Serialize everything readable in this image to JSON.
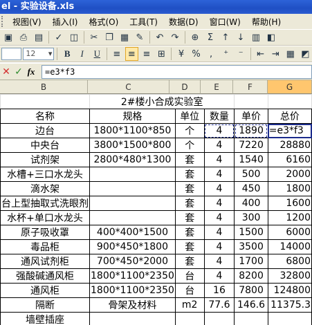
{
  "window": {
    "title": "el - 实验设备.xls"
  },
  "menu": [
    "视图(V)",
    "插入(I)",
    "格式(O)",
    "工具(T)",
    "数据(D)",
    "窗口(W)",
    "帮助(H)"
  ],
  "toolbar": {
    "font_size": "12",
    "zoom_symbol": "Σ"
  },
  "formula_bar": {
    "cancel": "✕",
    "enter": "✓",
    "fx": "fx",
    "value": "=e3*f3"
  },
  "columns": [
    "B",
    "C",
    "D",
    "E",
    "F",
    "G"
  ],
  "sheet": {
    "title": "2#楼小合成实验室",
    "headers": [
      "名称",
      "规格",
      "单位",
      "数量",
      "单价",
      "总价"
    ],
    "rows": [
      [
        "边台",
        "1800*1100*850",
        "个",
        "4",
        "1890",
        "=e3*f3"
      ],
      [
        "中央台",
        "3800*1500*800",
        "个",
        "4",
        "7220",
        "28880"
      ],
      [
        "试剂架",
        "2800*480*1300",
        "套",
        "4",
        "1540",
        "6160"
      ],
      [
        "水槽+三口水龙头",
        "",
        "套",
        "4",
        "500",
        "2000"
      ],
      [
        "滴水架",
        "",
        "套",
        "4",
        "450",
        "1800"
      ],
      [
        "台上型抽取式洗眼剂",
        "",
        "套",
        "4",
        "400",
        "1600"
      ],
      [
        "水杯+单口水龙头",
        "",
        "套",
        "4",
        "300",
        "1200"
      ],
      [
        "原子吸收罩",
        "400*400*1500",
        "套",
        "4",
        "1500",
        "6000"
      ],
      [
        "毒品柜",
        "900*450*1800",
        "套",
        "4",
        "3500",
        "14000"
      ],
      [
        "通风试剂柜",
        "700*450*2000",
        "套",
        "4",
        "1700",
        "6800"
      ],
      [
        "强酸碱通风柜",
        "1800*1100*2350",
        "台",
        "4",
        "8200",
        "32800"
      ],
      [
        "通风柜",
        "1800*1100*2350",
        "台",
        "16",
        "7800",
        "124800"
      ],
      [
        "隔断",
        "骨架及材料",
        "m2",
        "77.6",
        "146.6",
        "11375.3"
      ],
      [
        "墙壁插座",
        "",
        "",
        "",
        "",
        ""
      ]
    ]
  }
}
